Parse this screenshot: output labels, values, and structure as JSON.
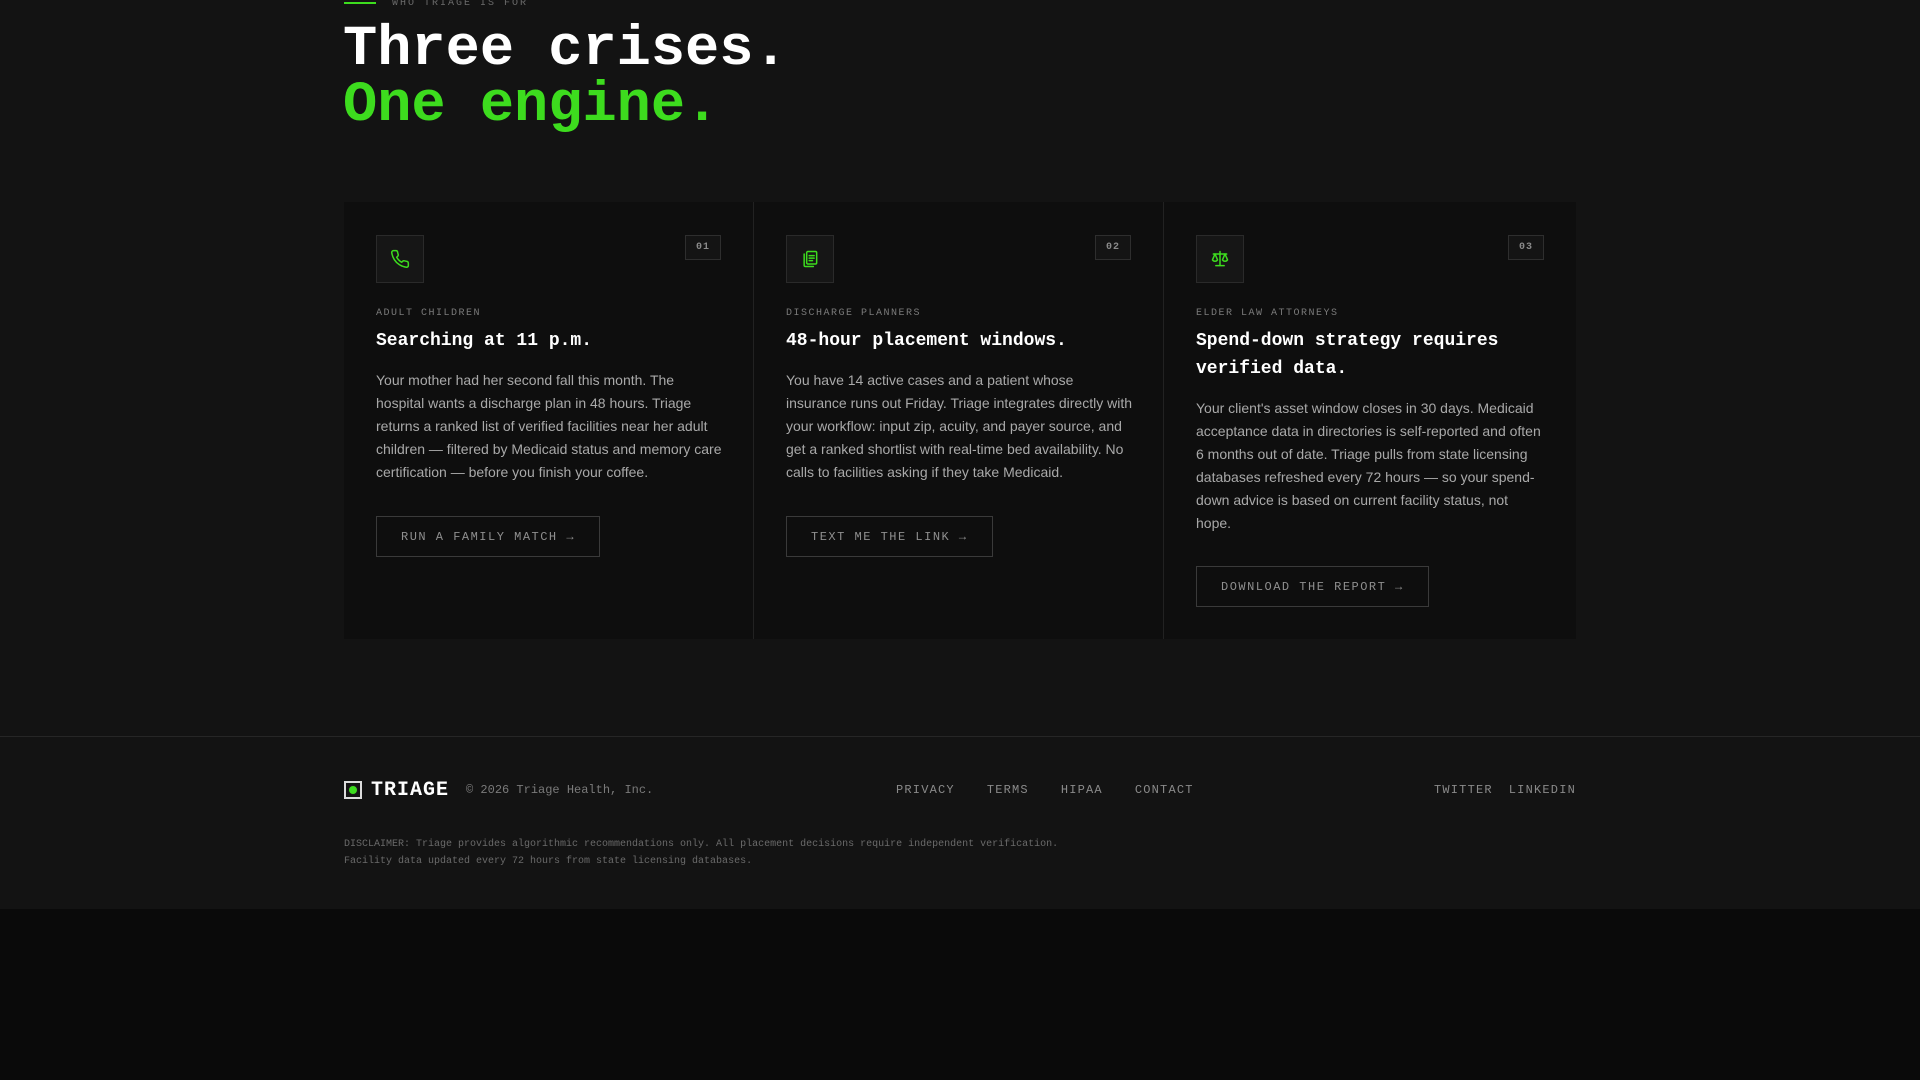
{
  "section": {
    "eyebrow": "WHO TRIAGE IS FOR",
    "heading_line1": "Three crises.",
    "heading_line2": "One engine.",
    "accent_color": "#3ddc1e"
  },
  "cards": [
    {
      "number": "01",
      "icon": "phone-icon",
      "label": "ADULT CHILDREN",
      "title": "Searching at 11 p.m.",
      "body": "Your mother had her second fall this month. The hospital wants a discharge plan in 48 hours. Triage returns a ranked list of verified facilities near her adult children — filtered by Medicaid status and memory care certification — before you finish your coffee.",
      "button": "RUN A FAMILY MATCH →"
    },
    {
      "number": "02",
      "icon": "clipboard-icon",
      "label": "DISCHARGE PLANNERS",
      "title": "48-hour placement windows.",
      "body": "You have 14 active cases and a patient whose insurance runs out Friday. Triage integrates directly with your workflow: input zip, acuity, and payer source, and get a ranked shortlist with real-time bed availability. No calls to facilities asking if they take Medicaid.",
      "button": "TEXT ME THE LINK →"
    },
    {
      "number": "03",
      "icon": "scale-icon",
      "label": "ELDER LAW ATTORNEYS",
      "title": "Spend-down strategy requires verified data.",
      "body": "Your client's asset window closes in 30 days. Medicaid acceptance data in directories is self-reported and often 6 months out of date. Triage pulls from state licensing databases refreshed every 72 hours — so your spend-down advice is based on current facility status, not hope.",
      "button": "DOWNLOAD THE REPORT →"
    }
  ],
  "footer": {
    "brand": "TRIAGE",
    "copyright": "© 2026 Triage Health, Inc.",
    "nav": [
      "PRIVACY",
      "TERMS",
      "HIPAA",
      "CONTACT"
    ],
    "social": [
      "TWITTER",
      "LINKEDIN"
    ],
    "disclaimer_line1": "DISCLAIMER: Triage provides algorithmic recommendations only. All placement decisions require independent verification.",
    "disclaimer_line2": "Facility data updated every 72 hours from state licensing databases."
  }
}
